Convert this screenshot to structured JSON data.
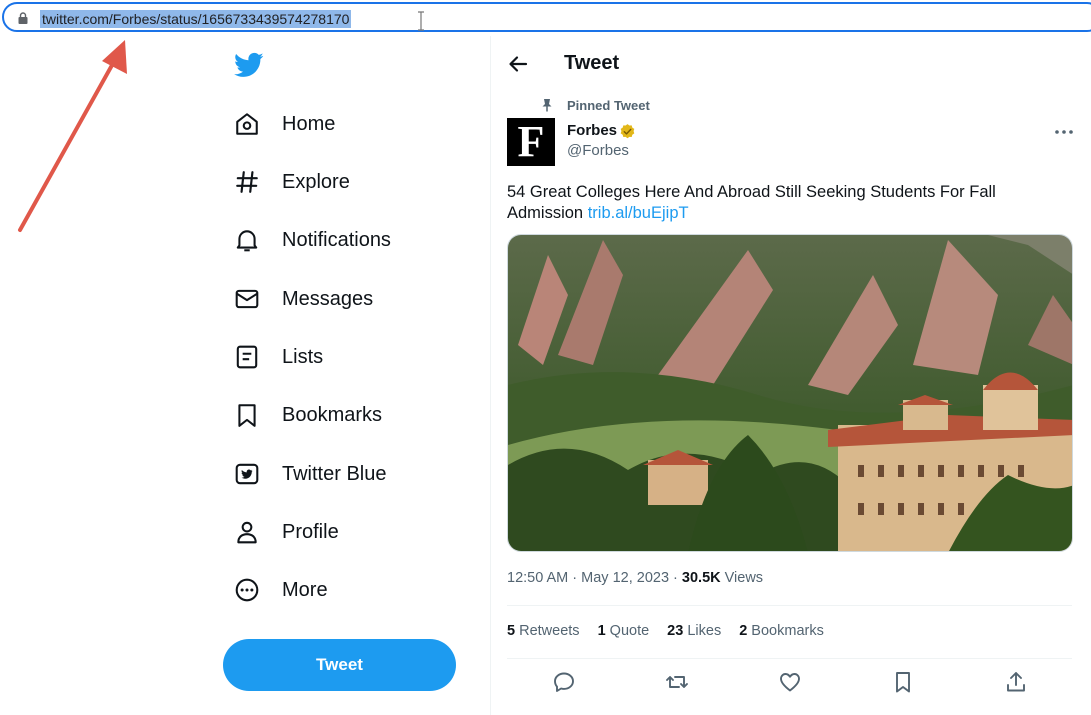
{
  "browser": {
    "url": "twitter.com/Forbes/status/1656733439574278170"
  },
  "nav": {
    "items": [
      {
        "label": "Home",
        "icon": "home-icon"
      },
      {
        "label": "Explore",
        "icon": "hashtag-icon"
      },
      {
        "label": "Notifications",
        "icon": "bell-icon"
      },
      {
        "label": "Messages",
        "icon": "envelope-icon"
      },
      {
        "label": "Lists",
        "icon": "list-icon"
      },
      {
        "label": "Bookmarks",
        "icon": "bookmark-icon"
      },
      {
        "label": "Twitter Blue",
        "icon": "twitter-blue-icon"
      },
      {
        "label": "Profile",
        "icon": "person-icon"
      },
      {
        "label": "More",
        "icon": "more-circle-icon"
      }
    ],
    "tweet_button": "Tweet"
  },
  "main": {
    "title": "Tweet",
    "pinned_label": "Pinned Tweet",
    "author": {
      "name": "Forbes",
      "handle": "@Forbes",
      "avatar_letter": "F"
    },
    "text": "54 Great Colleges Here And Abroad Still Seeking Students For Fall Admission ",
    "link": "trib.al/buEjipT",
    "meta": {
      "time": "12:50 AM · May 12, 2023 · ",
      "views_count": "30.5K",
      "views_label": " Views"
    },
    "stats": [
      {
        "count": "5",
        "label": " Retweets"
      },
      {
        "count": "1",
        "label": " Quote"
      },
      {
        "count": "23",
        "label": " Likes"
      },
      {
        "count": "2",
        "label": " Bookmarks"
      }
    ]
  },
  "colors": {
    "accent": "#1d9bf0",
    "annotation_arrow": "#e0584a",
    "url_highlight": "#8fb8ea"
  }
}
